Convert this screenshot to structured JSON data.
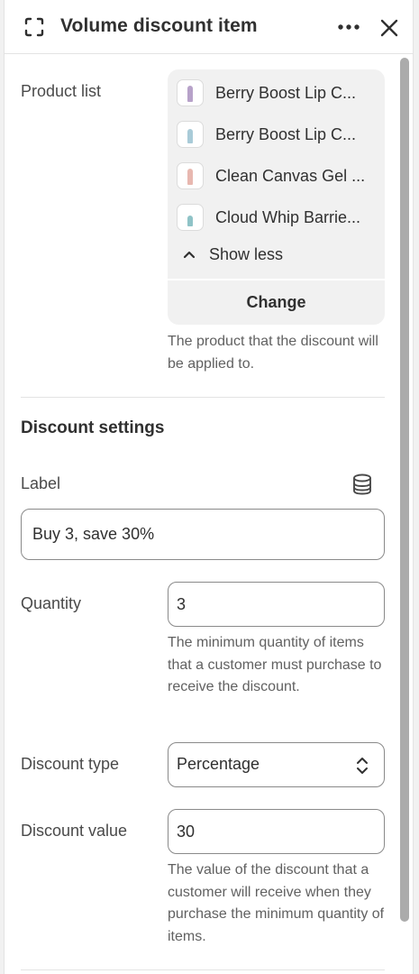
{
  "header": {
    "title": "Volume discount item",
    "icons": {
      "focus": "focus-frame-icon",
      "more": "more-horizontal-icon",
      "close": "close-icon"
    }
  },
  "product_list": {
    "label": "Product list",
    "items": [
      {
        "name": "Berry Boost Lip C...",
        "color": "#b7a2c9"
      },
      {
        "name": "Berry Boost Lip C...",
        "color": "#a9cbd8"
      },
      {
        "name": "Clean Canvas Gel ...",
        "color": "#e8b8b0"
      },
      {
        "name": "Cloud Whip Barrie...",
        "color": "#8fc3c7"
      }
    ],
    "show_less_label": "Show less",
    "change_label": "Change",
    "help": "The product that the discount will be applied to."
  },
  "discount_settings": {
    "title": "Discount settings",
    "label_field": {
      "label": "Label",
      "value": "Buy 3, save 30%",
      "icon": "database-icon"
    },
    "quantity": {
      "label": "Quantity",
      "value": "3",
      "help": "The minimum quantity of items that a customer must purchase to receive the discount."
    },
    "discount_type": {
      "label": "Discount type",
      "value": "Percentage"
    },
    "discount_value": {
      "label": "Discount value",
      "value": "30",
      "help": "The value of the discount that a customer will receive when they purchase the minimum quantity of items."
    }
  }
}
